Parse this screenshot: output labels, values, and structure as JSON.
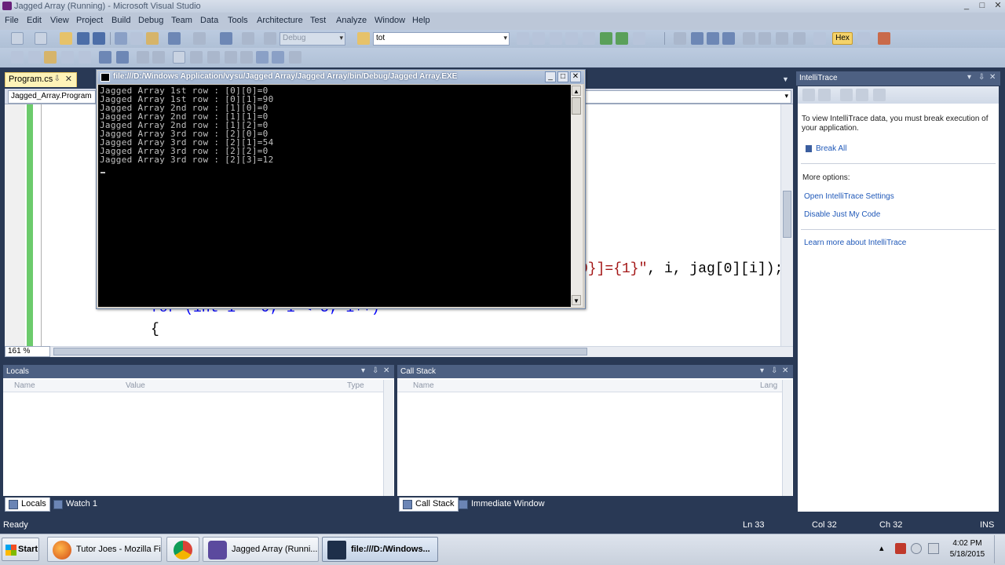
{
  "window": {
    "title": "Jagged Array (Running) - Microsoft Visual Studio",
    "min": "_",
    "max": "□",
    "close": "✕"
  },
  "menu": [
    "File",
    "Edit",
    "View",
    "Project",
    "Build",
    "Debug",
    "Team",
    "Data",
    "Tools",
    "Architecture",
    "Test",
    "Analyze",
    "Window",
    "Help"
  ],
  "toolbar": {
    "config": "Debug",
    "find": "tot",
    "hex_label": "Hex"
  },
  "doc_tab": {
    "label": "Program.cs",
    "pin": "⇩",
    "close": "✕"
  },
  "nav": {
    "class_combo": "Jagged_Array.Program"
  },
  "code_lines": [
    {
      "pre": "",
      "str": "0}]={1}\"",
      "post": ", i, jag[0][i]);"
    },
    {
      "pre": "for (int i = 0; i < 5; i++)",
      "str": "",
      "post": ""
    },
    {
      "pre": "{",
      "str": "",
      "post": ""
    }
  ],
  "zoom": "161 %",
  "console": {
    "title": "file:///D:/Windows Application/vysu/Jagged Array/Jagged Array/bin/Debug/Jagged Array.EXE",
    "lines": [
      "Jagged Array 1st row : [0][0]=0",
      "Jagged Array 1st row : [0][1]=90",
      "Jagged Array 2nd row : [1][0]=0",
      "Jagged Array 2nd row : [1][1]=0",
      "Jagged Array 2nd row : [1][2]=0",
      "Jagged Array 3rd row : [2][0]=0",
      "Jagged Array 3rd row : [2][1]=54",
      "Jagged Array 3rd row : [2][2]=0",
      "Jagged Array 3rd row : [2][3]=12"
    ]
  },
  "intellitrace": {
    "title": "IntelliTrace",
    "message": "To view IntelliTrace data, you must break execution of your application.",
    "break_all": "Break All",
    "more_options": "More options:",
    "open_settings": "Open IntelliTrace Settings",
    "disable_jmc": "Disable Just My Code",
    "learn_more": "Learn more about IntelliTrace"
  },
  "locals": {
    "title": "Locals",
    "col_name": "Name",
    "col_value": "Value",
    "col_type": "Type"
  },
  "callstack": {
    "title": "Call Stack",
    "col_name": "Name",
    "col_lang": "Lang"
  },
  "bottom_tabs_left": [
    "Locals",
    "Watch 1"
  ],
  "bottom_tabs_right": [
    "Call Stack",
    "Immediate Window"
  ],
  "status": {
    "ready": "Ready",
    "ln": "Ln 33",
    "col": "Col 32",
    "ch": "Ch 32",
    "mode": "INS"
  },
  "taskbar": {
    "start": "Start",
    "tasks": [
      "Tutor Joes - Mozilla Fi...",
      "",
      "Jagged Array (Runni...",
      "file:///D:/Windows..."
    ],
    "time": "4:02 PM",
    "date": "5/18/2015"
  },
  "colors": {
    "vs_dark": "#293955",
    "panel_header": "#4d6082",
    "link": "#1f58b8",
    "console_bg": "#000000"
  }
}
